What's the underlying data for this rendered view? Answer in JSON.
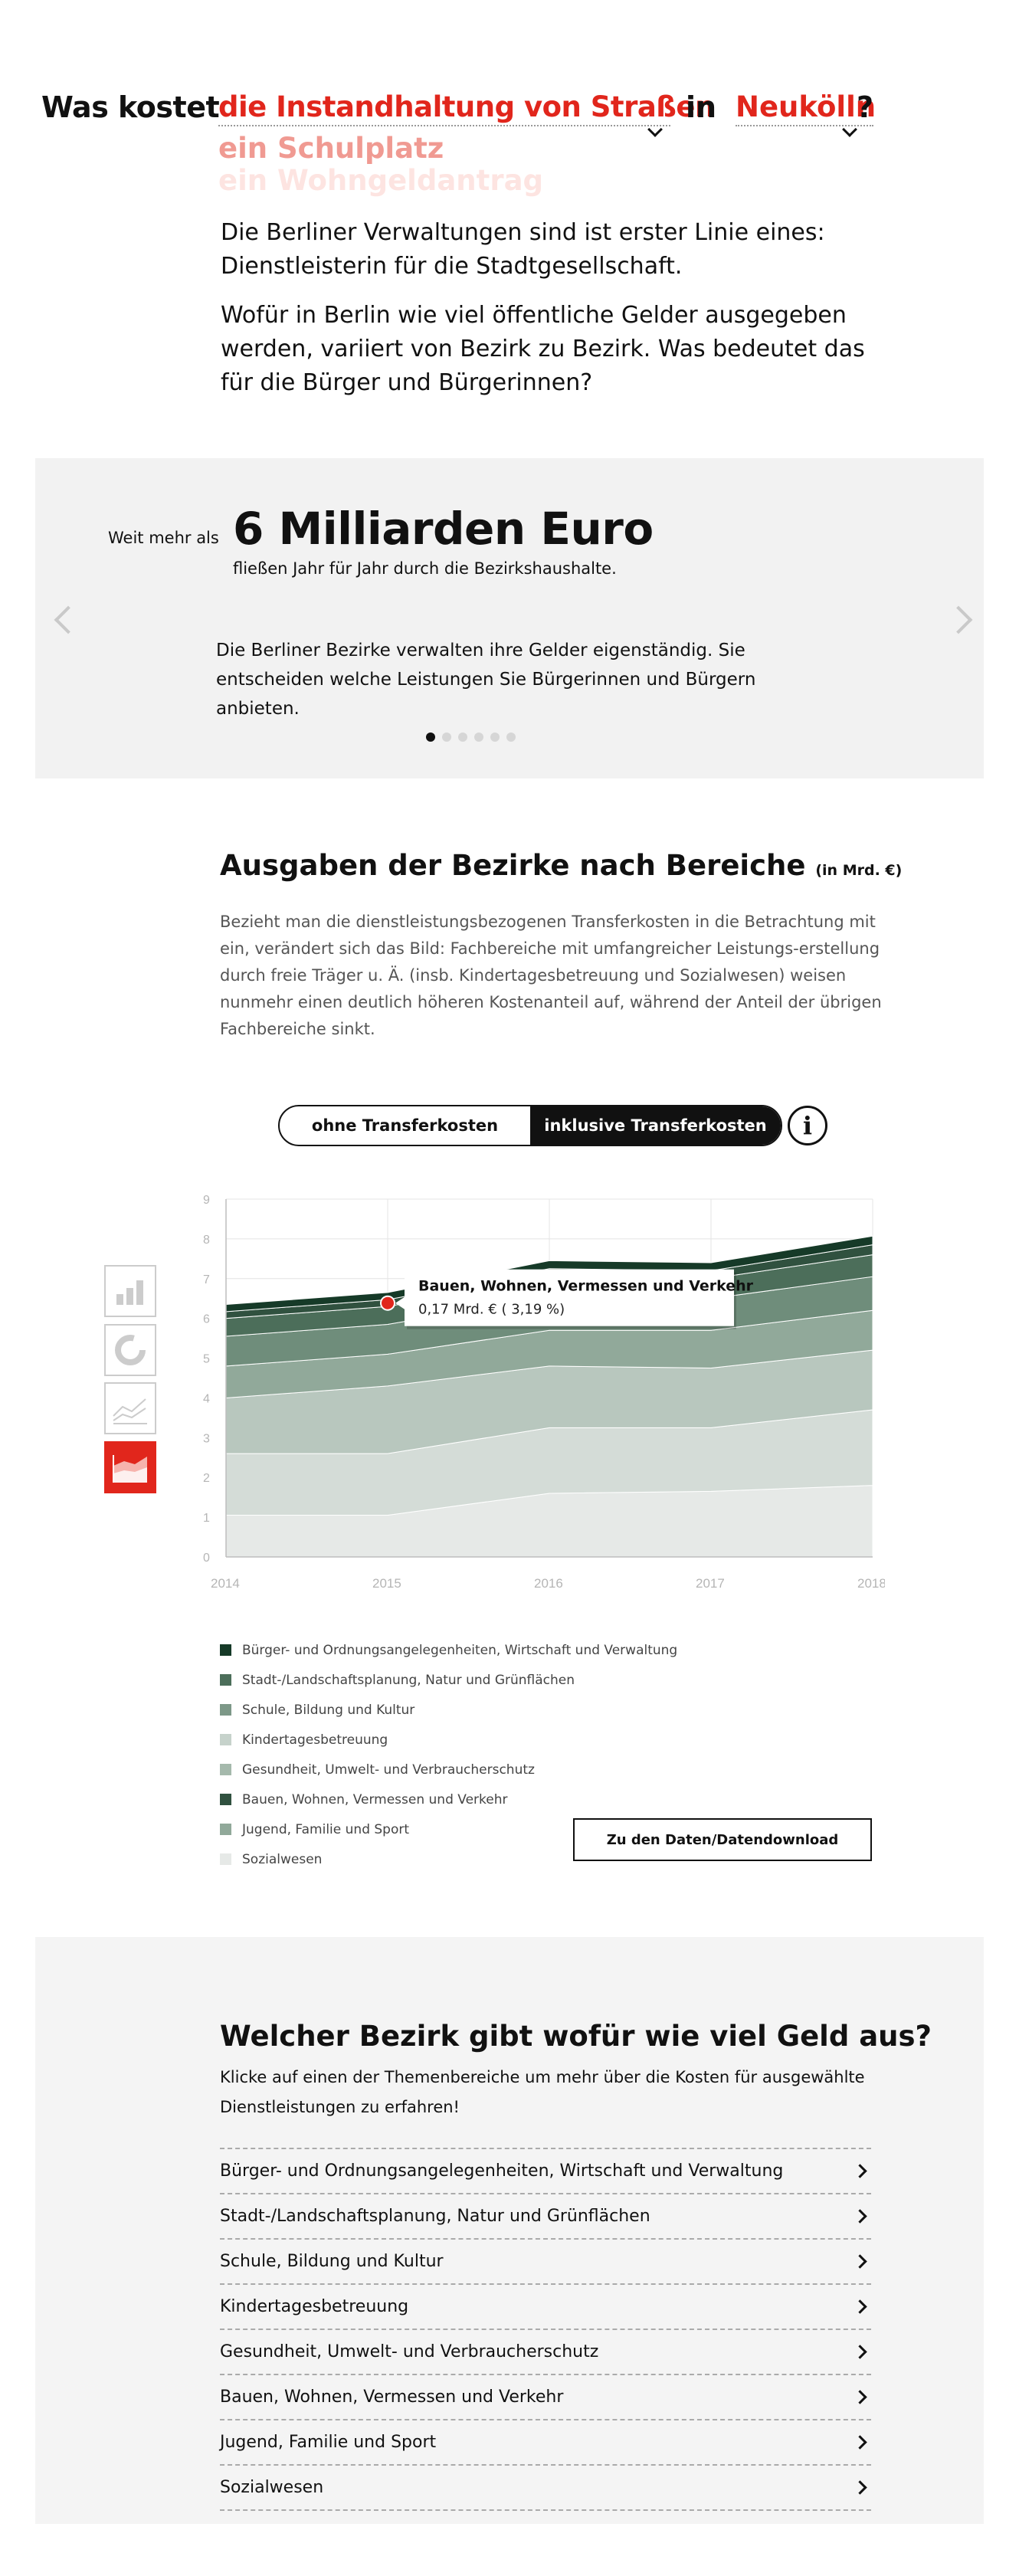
{
  "hero": {
    "prefix": "Was kostet",
    "topic_selected": "die Instandhaltung von Straßen",
    "topic_options": [
      "ein Schulplatz",
      "ein Wohngeldantrag"
    ],
    "in_word": "in",
    "district_selected": "Neukölln",
    "question_mark": "?",
    "intro_1": "Die Berliner Verwaltungen sind ist erster Linie eines: Dienstleisterin für die Stadtgesellschaft.",
    "intro_2": "Wofür in Berlin wie viel öffentliche Gelder ausgegeben werden, variiert von Bezirk zu Bezirk. Was bedeutet das für die Bürger und Bürgerinnen?"
  },
  "slider": {
    "pre": "Weit mehr als",
    "big": "6 Milliarden Euro",
    "sub": "fließen Jahr für Jahr durch die Bezirkshaushalte.",
    "text": "Die Berliner Bezirke verwalten ihre Gelder eigenständig. Sie entscheiden welche Leistungen Sie Bürgerinnen und Bürgern anbieten.",
    "dot_count": 6,
    "active_dot": 0
  },
  "section": {
    "title": "Ausgaben der Bezirke nach Bereiche",
    "title_unit": "(in Mrd. €)",
    "desc": "Bezieht man die dienstleistungsbezogenen Transferkosten in die Betrachtung mit ein, verändert sich das Bild: Fachbereiche mit umfangreicher Leistungs-erstellung durch freie Träger u. Ä. (insb. Kindertagesbetreuung und Sozialwesen) weisen nunmehr einen deutlich höheren Kostenanteil auf, während der Anteil der übrigen Fachbereiche sinkt.",
    "toggle_left": "ohne Transferkosten",
    "toggle_right": "inklusive Transferkosten",
    "info": "i",
    "chart_types": [
      "bar-chart-icon",
      "donut-chart-icon",
      "line-chart-icon",
      "area-chart-icon"
    ],
    "download_label": "Zu den Daten/Datendownload"
  },
  "chart_data": {
    "type": "area",
    "stacked": true,
    "x": [
      "2014",
      "2015",
      "2016",
      "2017",
      "2018"
    ],
    "ylim": [
      0,
      9
    ],
    "yticks": [
      "0",
      "1",
      "2",
      "3",
      "4",
      "5",
      "6",
      "7",
      "8",
      "9"
    ],
    "grid": true,
    "series": [
      {
        "name": "Sozialwesen",
        "color": "#e6e9e7",
        "values": [
          1.05,
          1.05,
          1.6,
          1.65,
          1.8
        ]
      },
      {
        "name": "Jugend, Familie und Sport",
        "color": "#d4dcd7",
        "values": [
          1.55,
          1.55,
          1.65,
          1.6,
          1.9
        ]
      },
      {
        "name": "Kindertagesbetreuung",
        "color": "#b8c7be",
        "values": [
          1.4,
          1.7,
          1.55,
          1.5,
          1.5
        ]
      },
      {
        "name": "Gesundheit, Umwelt- und Verbraucherschutz",
        "color": "#91a99a",
        "values": [
          0.8,
          0.8,
          0.9,
          0.95,
          1.0
        ]
      },
      {
        "name": "Schule, Bildung und Kultur",
        "color": "#6f8d7b",
        "values": [
          0.75,
          0.75,
          0.85,
          0.8,
          0.85
        ]
      },
      {
        "name": "Stadt-/Landschaftsplanung, Natur und Grünflächen",
        "color": "#4c6e5a",
        "values": [
          0.45,
          0.45,
          0.5,
          0.5,
          0.55
        ]
      },
      {
        "name": "Bauen, Wohnen, Vermessen und Verkehr",
        "color": "#30513f",
        "values": [
          0.17,
          0.17,
          0.2,
          0.2,
          0.25
        ]
      },
      {
        "name": "Bürger- und Ordnungsangelegenheiten, Wirtschaft und Verwaltung",
        "color": "#163a28",
        "values": [
          0.18,
          0.18,
          0.2,
          0.2,
          0.22
        ]
      }
    ],
    "tooltip": {
      "title": "Bauen, Wohnen, Vermessen und Verkehr",
      "value": "0,17 Mrd. € ( 3,19 %)",
      "x_index": 1,
      "series_index": 6
    }
  },
  "legend": [
    {
      "label": "Bürger- und Ordnungsangelegenheiten, Wirtschaft und Verwaltung",
      "color": "#163a28"
    },
    {
      "label": "Stadt-/Landschaftsplanung, Natur und Grünflächen",
      "color": "#4c6e5a"
    },
    {
      "label": "Schule, Bildung und Kultur",
      "color": "#7d9888"
    },
    {
      "label": "Kindertagesbetreuung",
      "color": "#c6d2cb"
    },
    {
      "label": "Gesundheit, Umwelt- und Verbraucherschutz",
      "color": "#a5b9ac"
    },
    {
      "label": "Bauen, Wohnen, Vermessen und Verkehr",
      "color": "#30513f"
    },
    {
      "label": "Jugend, Familie und Sport",
      "color": "#91a99a"
    },
    {
      "label": "Sozialwesen",
      "color": "#e6e9e7"
    }
  ],
  "bezirk": {
    "title": "Welcher Bezirk gibt wofür wie viel Geld aus?",
    "desc": "Klicke auf einen der Themenbereiche um mehr über die Kosten für ausgewählte Dienstleistungen zu erfahren!",
    "items": [
      "Bürger- und Ordnungsangelegenheiten, Wirtschaft und Verwaltung",
      "Stadt-/Landschaftsplanung, Natur und Grünflächen",
      "Schule, Bildung und Kultur",
      "Kindertagesbetreuung",
      "Gesundheit, Umwelt- und Verbraucherschutz",
      "Bauen, Wohnen, Vermessen und Verkehr",
      "Jugend, Familie und Sport",
      "Sozialwesen"
    ]
  },
  "colors": {
    "accent": "#e1261c",
    "light_bg": "#f2f2f2"
  }
}
